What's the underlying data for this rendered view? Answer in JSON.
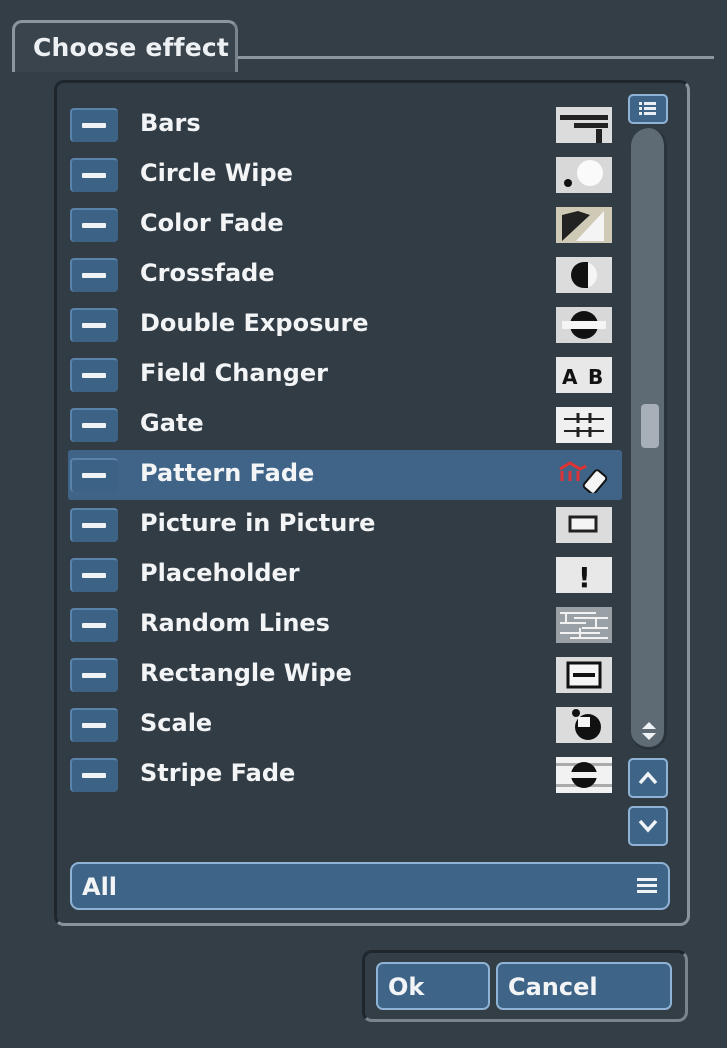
{
  "dialog": {
    "title": "Choose effect"
  },
  "effects": [
    {
      "label": "Bars",
      "icon": "bars-icon"
    },
    {
      "label": "Circle Wipe",
      "icon": "circle-wipe-icon"
    },
    {
      "label": "Color Fade",
      "icon": "color-fade-icon"
    },
    {
      "label": "Crossfade",
      "icon": "crossfade-icon"
    },
    {
      "label": "Double Exposure",
      "icon": "double-exposure-icon"
    },
    {
      "label": "Field Changer",
      "icon": "field-changer-icon",
      "icon_text": "A B"
    },
    {
      "label": "Gate",
      "icon": "gate-icon"
    },
    {
      "label": "Pattern Fade",
      "icon": "pattern-fade-icon",
      "selected": true
    },
    {
      "label": "Picture in Picture",
      "icon": "picture-in-picture-icon"
    },
    {
      "label": "Placeholder",
      "icon": "placeholder-icon",
      "icon_text": "!"
    },
    {
      "label": "Random Lines",
      "icon": "random-lines-icon"
    },
    {
      "label": "Rectangle Wipe",
      "icon": "rectangle-wipe-icon"
    },
    {
      "label": "Scale",
      "icon": "scale-icon"
    },
    {
      "label": "Stripe Fade",
      "icon": "stripe-fade-icon"
    }
  ],
  "filter": {
    "selected": "All"
  },
  "buttons": {
    "ok": "Ok",
    "cancel": "Cancel"
  },
  "colors": {
    "background": "#343e47",
    "accent": "#3e6488",
    "selected_row": "#3f6488",
    "text": "#f2f4f6"
  }
}
